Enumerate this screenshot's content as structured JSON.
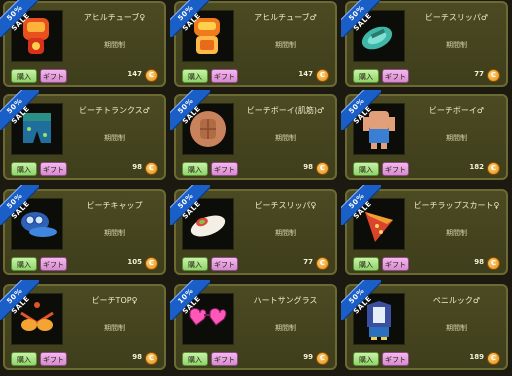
{
  "coin_symbol": "C",
  "items": [
    {
      "name": "アヒルチューブ♀",
      "period": "期間制",
      "buy": "購入",
      "gift": "ギフト",
      "price": "147",
      "sale": {
        "pct": "50%",
        "word": "SALE"
      },
      "icon": "duck-tube-icon"
    },
    {
      "name": "アヒルチューブ♂",
      "period": "期間制",
      "buy": "購入",
      "gift": "ギフト",
      "price": "147",
      "sale": {
        "pct": "50%",
        "word": "SALE"
      },
      "icon": "duck-tube-icon"
    },
    {
      "name": "ビーチスリッパ♂",
      "period": "期間制",
      "buy": "購入",
      "gift": "ギフト",
      "price": "77",
      "sale": {
        "pct": "50%",
        "word": "SALE"
      },
      "icon": "beach-slipper-icon"
    },
    {
      "name": "ビーチトランクス♂",
      "period": "期間制",
      "buy": "購入",
      "gift": "ギフト",
      "price": "98",
      "sale": {
        "pct": "50%",
        "word": "SALE"
      },
      "icon": "beach-trunks-icon"
    },
    {
      "name": "ビーチボーイ(肌筋)♂",
      "period": "期間制",
      "buy": "購入",
      "gift": "ギフト",
      "price": "98",
      "sale": {
        "pct": "50%",
        "word": "SALE"
      },
      "icon": "muscle-body-icon"
    },
    {
      "name": "ビーチボーイ♂",
      "period": "期間制",
      "buy": "購入",
      "gift": "ギフト",
      "price": "182",
      "sale": {
        "pct": "50%",
        "word": "SALE"
      },
      "icon": "beach-boy-icon"
    },
    {
      "name": "ビーチキャップ",
      "period": "期間制",
      "buy": "購入",
      "gift": "ギフト",
      "price": "105",
      "sale": {
        "pct": "50%",
        "word": "SALE"
      },
      "icon": "beach-cap-icon"
    },
    {
      "name": "ビーチスリッパ♀",
      "period": "期間制",
      "buy": "購入",
      "gift": "ギフト",
      "price": "77",
      "sale": {
        "pct": "50%",
        "word": "SALE"
      },
      "icon": "beach-slipper-icon"
    },
    {
      "name": "ビーチラップスカート♀",
      "period": "期間制",
      "buy": "購入",
      "gift": "ギフト",
      "price": "98",
      "sale": {
        "pct": "50%",
        "word": "SALE"
      },
      "icon": "wrap-skirt-icon"
    },
    {
      "name": "ビーチTOP♀",
      "period": "期間制",
      "buy": "購入",
      "gift": "ギフト",
      "price": "98",
      "sale": {
        "pct": "50%",
        "word": "SALE"
      },
      "icon": "bikini-top-icon"
    },
    {
      "name": "ハートサングラス",
      "period": "期間制",
      "buy": "購入",
      "gift": "ギフト",
      "price": "99",
      "sale": {
        "pct": "10%",
        "word": "SALE"
      },
      "icon": "heart-sunglasses-icon"
    },
    {
      "name": "ペニルック♂",
      "period": "期間制",
      "buy": "購入",
      "gift": "ギフト",
      "price": "189",
      "sale": {
        "pct": "50%",
        "word": "SALE"
      },
      "icon": "penguin-look-icon"
    }
  ]
}
